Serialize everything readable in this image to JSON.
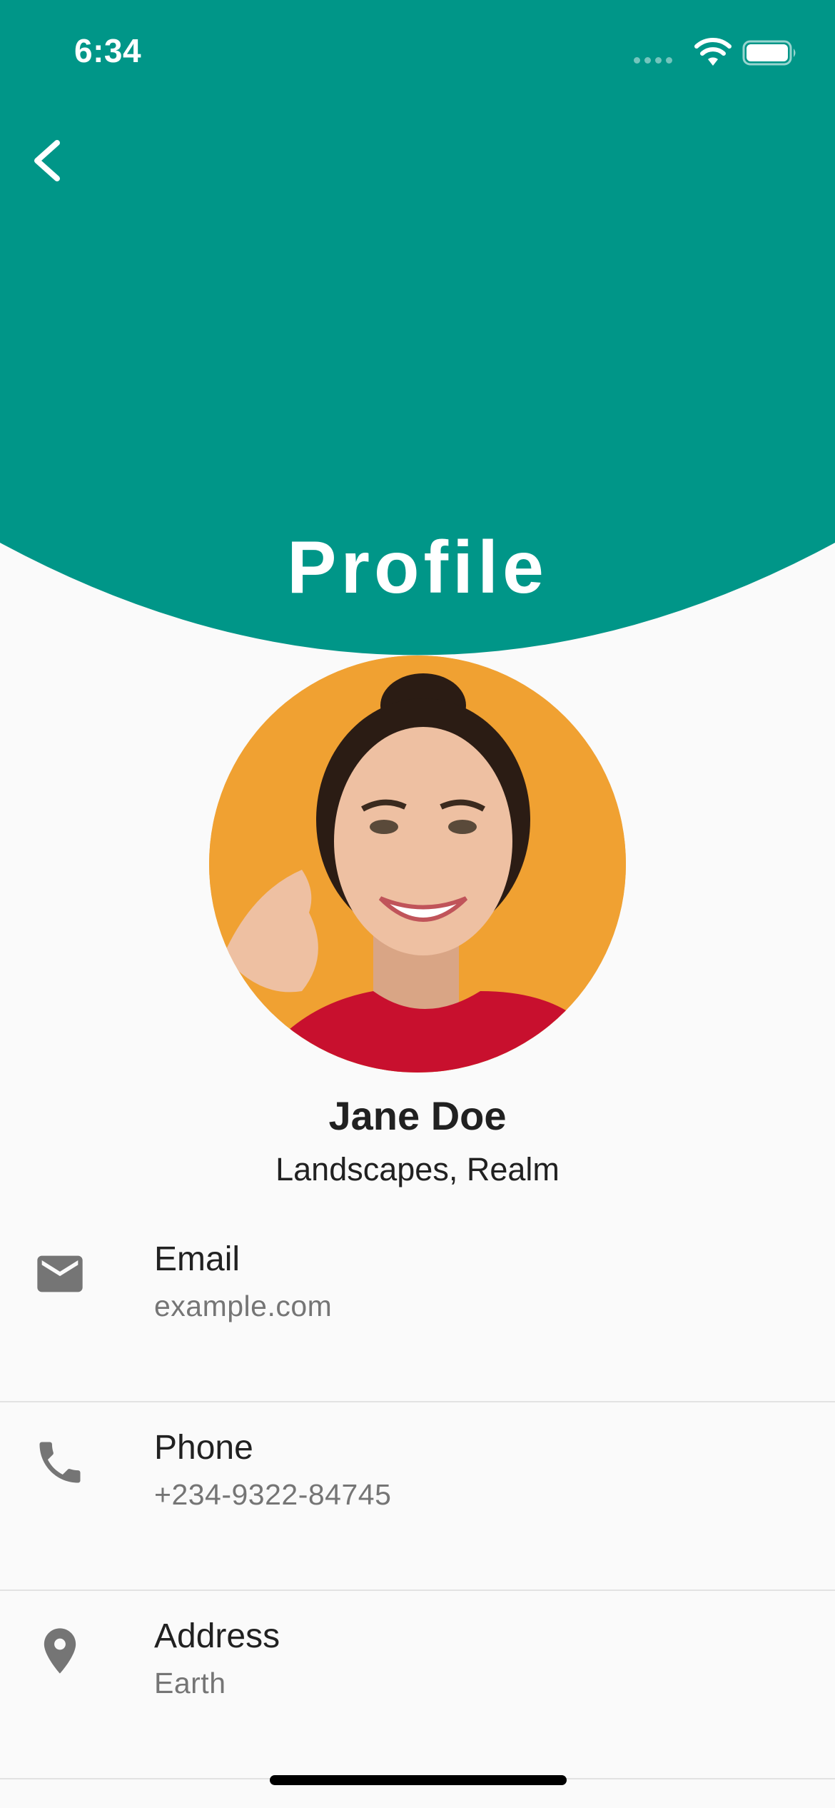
{
  "colors": {
    "accent": "#009688",
    "background": "#fafafa",
    "avatar_bg": "#f0a132",
    "text_primary": "#212121",
    "text_secondary": "#757575",
    "icon": "#757575"
  },
  "status_bar": {
    "time": "6:34",
    "icons": [
      "cellular-signal-icon",
      "wifi-icon",
      "battery-icon"
    ]
  },
  "header": {
    "back_icon": "chevron-left-icon",
    "title": "Profile"
  },
  "profile": {
    "name": "Jane Doe",
    "subtitle": "Landscapes, Realm"
  },
  "info_items": [
    {
      "icon": "email-icon",
      "label": "Email",
      "value": "example.com"
    },
    {
      "icon": "phone-icon",
      "label": "Phone",
      "value": "+234-9322-84745"
    },
    {
      "icon": "location-pin-icon",
      "label": "Address",
      "value": "Earth"
    }
  ]
}
